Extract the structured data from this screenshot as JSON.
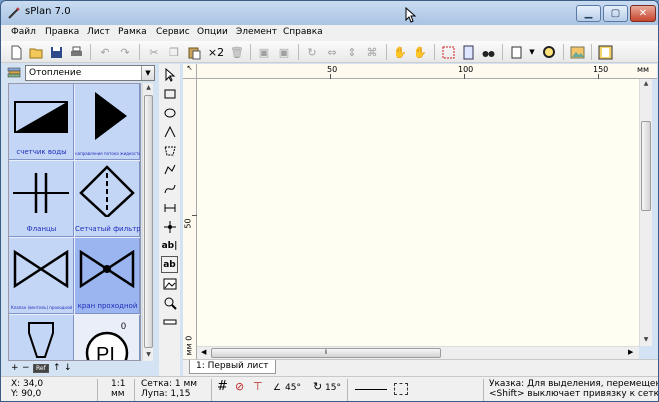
{
  "window": {
    "title": "sPlan 7.0",
    "minimize": "▁",
    "maximize": "▢",
    "close": "✕"
  },
  "menu": [
    "Файл",
    "Правка",
    "Лист",
    "Рамка",
    "Сервис",
    "Опции",
    "Элемент",
    "Справка"
  ],
  "toolbar": {
    "count_x2": "×2"
  },
  "library": {
    "selected": "Отопление",
    "items": [
      {
        "label": "счетчик воды"
      },
      {
        "label": "направление потока жидкости"
      },
      {
        "label": "Фланцы"
      },
      {
        "label": "Сетчатый фильтр"
      },
      {
        "label": "Клапан (вентиль) проходной"
      },
      {
        "label": "кран проходной"
      },
      {
        "label": ""
      },
      {
        "label": "PI",
        "extra": "0"
      }
    ],
    "nav": {
      "plus": "+",
      "minus": "−",
      "box": "Ref",
      "up": "↑",
      "down": "↓"
    }
  },
  "vtools": {
    "text1": "ab|",
    "text2": "ab"
  },
  "ruler": {
    "corner": "↖",
    "h_labels": [
      "50",
      "100",
      "150",
      "мм"
    ],
    "v_labels": [
      "50",
      "мм 0"
    ]
  },
  "sheet_tab": "1: Первый лист",
  "status": {
    "x": "X: 34,0",
    "y": "Y: 90,0",
    "scale": "1:1",
    "scale_unit": "мм",
    "grid": "Сетка: 1 мм",
    "zoom": "Лупа:  1,15",
    "angle1": "45°",
    "angle2": "15°",
    "hint1": "Указка: Для выделения, перемещения и у",
    "hint2": "<Shift> выключает привязку к сетке. <Spa"
  },
  "colors": {
    "canvas": "#fffef2",
    "library_cell": "#c4d6f6",
    "library_selected": "#9ab5ef",
    "label": "#1e2dbd"
  }
}
